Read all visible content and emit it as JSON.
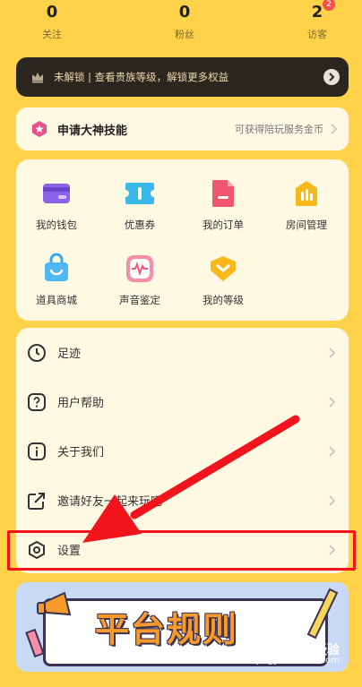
{
  "stats": [
    {
      "value": "0",
      "label": "关注"
    },
    {
      "value": "0",
      "label": "粉丝"
    },
    {
      "value": "2",
      "label": "访客",
      "badge": "2"
    }
  ],
  "vip_bar": {
    "text": "未解锁 | 查看贵族等级，解锁更多权益"
  },
  "skill": {
    "title": "申请大神技能",
    "hint": "可获得陪玩服务金币"
  },
  "grid": [
    {
      "label": "我的钱包",
      "icon": "wallet-icon"
    },
    {
      "label": "优惠券",
      "icon": "coupon-icon"
    },
    {
      "label": "我的订单",
      "icon": "order-icon"
    },
    {
      "label": "房间管理",
      "icon": "room-manage-icon"
    },
    {
      "label": "道具商城",
      "icon": "shopping-bag-icon"
    },
    {
      "label": "声音鉴定",
      "icon": "voice-wave-icon"
    },
    {
      "label": "我的等级",
      "icon": "level-badge-icon"
    }
  ],
  "menu": [
    {
      "label": "足迹",
      "icon": "clock-icon"
    },
    {
      "label": "用户帮助",
      "icon": "question-icon"
    },
    {
      "label": "关于我们",
      "icon": "info-icon"
    },
    {
      "label": "邀请好友一起来玩吧",
      "icon": "share-icon"
    },
    {
      "label": "设置",
      "icon": "settings-hexagon-icon"
    }
  ],
  "banner": {
    "title": "平台规则"
  },
  "watermark": {
    "line1": "Bai 经验",
    "line2": "jingyan.baidu.com"
  },
  "colors": {
    "background": "#FFD24A",
    "card": "#FFF9E4",
    "highlight": "#F2141C",
    "vip_bg": "#2C2620"
  }
}
